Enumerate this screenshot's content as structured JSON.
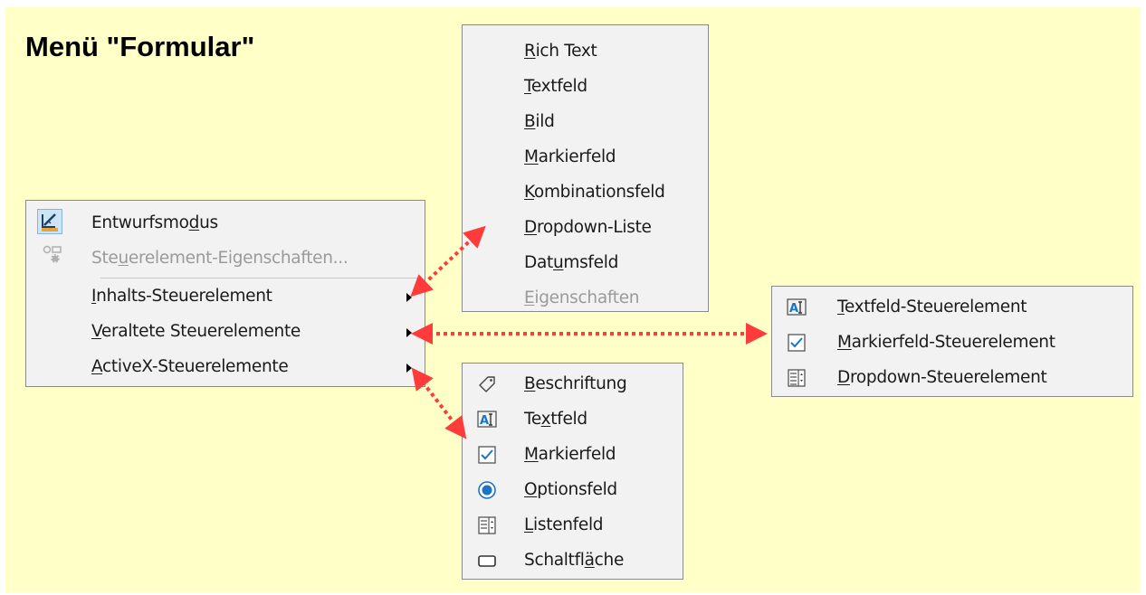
{
  "title": "Menü \"Formular\"",
  "colors": {
    "background": "#ffffc8",
    "arrow": "#ff3b3b",
    "menu_bg": "#f2f2f2",
    "accent": "#1b74c4"
  },
  "main_menu": {
    "items": [
      {
        "icon": "design-mode-icon",
        "parts": [
          "Entwurfsmo",
          "d",
          "us"
        ],
        "enabled": true
      },
      {
        "icon": "control-properties-icon",
        "parts": [
          "Ste",
          "u",
          "erelement-Eigenschaften..."
        ],
        "enabled": false
      },
      {
        "parts": [
          "",
          "I",
          "nhalts-Steuerelement"
        ],
        "enabled": true,
        "submenu": true
      },
      {
        "parts": [
          "",
          "V",
          "eraltete Steuerelemente"
        ],
        "enabled": true,
        "submenu": true
      },
      {
        "parts": [
          "",
          "A",
          "ctiveX-Steuerelemente"
        ],
        "enabled": true,
        "submenu": true
      }
    ]
  },
  "content_controls_menu": {
    "items": [
      {
        "parts": [
          "",
          "R",
          "ich Text"
        ],
        "enabled": true
      },
      {
        "parts": [
          "",
          "T",
          "extfeld"
        ],
        "enabled": true
      },
      {
        "parts": [
          "",
          "B",
          "ild"
        ],
        "enabled": true
      },
      {
        "parts": [
          "",
          "M",
          "arkierfeld"
        ],
        "enabled": true
      },
      {
        "parts": [
          "",
          "K",
          "ombinationsfeld"
        ],
        "enabled": true
      },
      {
        "parts": [
          "",
          "D",
          "ropdown-Liste"
        ],
        "enabled": true
      },
      {
        "parts": [
          "Dat",
          "u",
          "msfeld"
        ],
        "enabled": true
      },
      {
        "parts": [
          "",
          "E",
          "igenschaften"
        ],
        "enabled": false
      }
    ]
  },
  "legacy_controls_menu": {
    "items": [
      {
        "icon": "text-field-icon",
        "parts": [
          "",
          "T",
          "extfeld-Steuerelement"
        ]
      },
      {
        "icon": "checkbox-icon",
        "parts": [
          "",
          "M",
          "arkierfeld-Steuerelement"
        ]
      },
      {
        "icon": "dropdown-icon",
        "parts": [
          "",
          "D",
          "ropdown-Steuerelement"
        ]
      }
    ]
  },
  "activex_controls_menu": {
    "items": [
      {
        "icon": "label-tag-icon",
        "parts": [
          "",
          "B",
          "eschriftung"
        ]
      },
      {
        "icon": "text-field-icon",
        "parts": [
          "Te",
          "x",
          "tfeld"
        ]
      },
      {
        "icon": "checkbox-icon",
        "parts": [
          "",
          "M",
          "arkierfeld"
        ]
      },
      {
        "icon": "option-button-icon",
        "parts": [
          "",
          "O",
          "ptionsfeld"
        ]
      },
      {
        "icon": "list-box-icon",
        "parts": [
          "",
          "L",
          "istenfeld"
        ]
      },
      {
        "icon": "push-button-icon",
        "parts": [
          "Schaltfl",
          "ä",
          "che"
        ]
      }
    ]
  }
}
